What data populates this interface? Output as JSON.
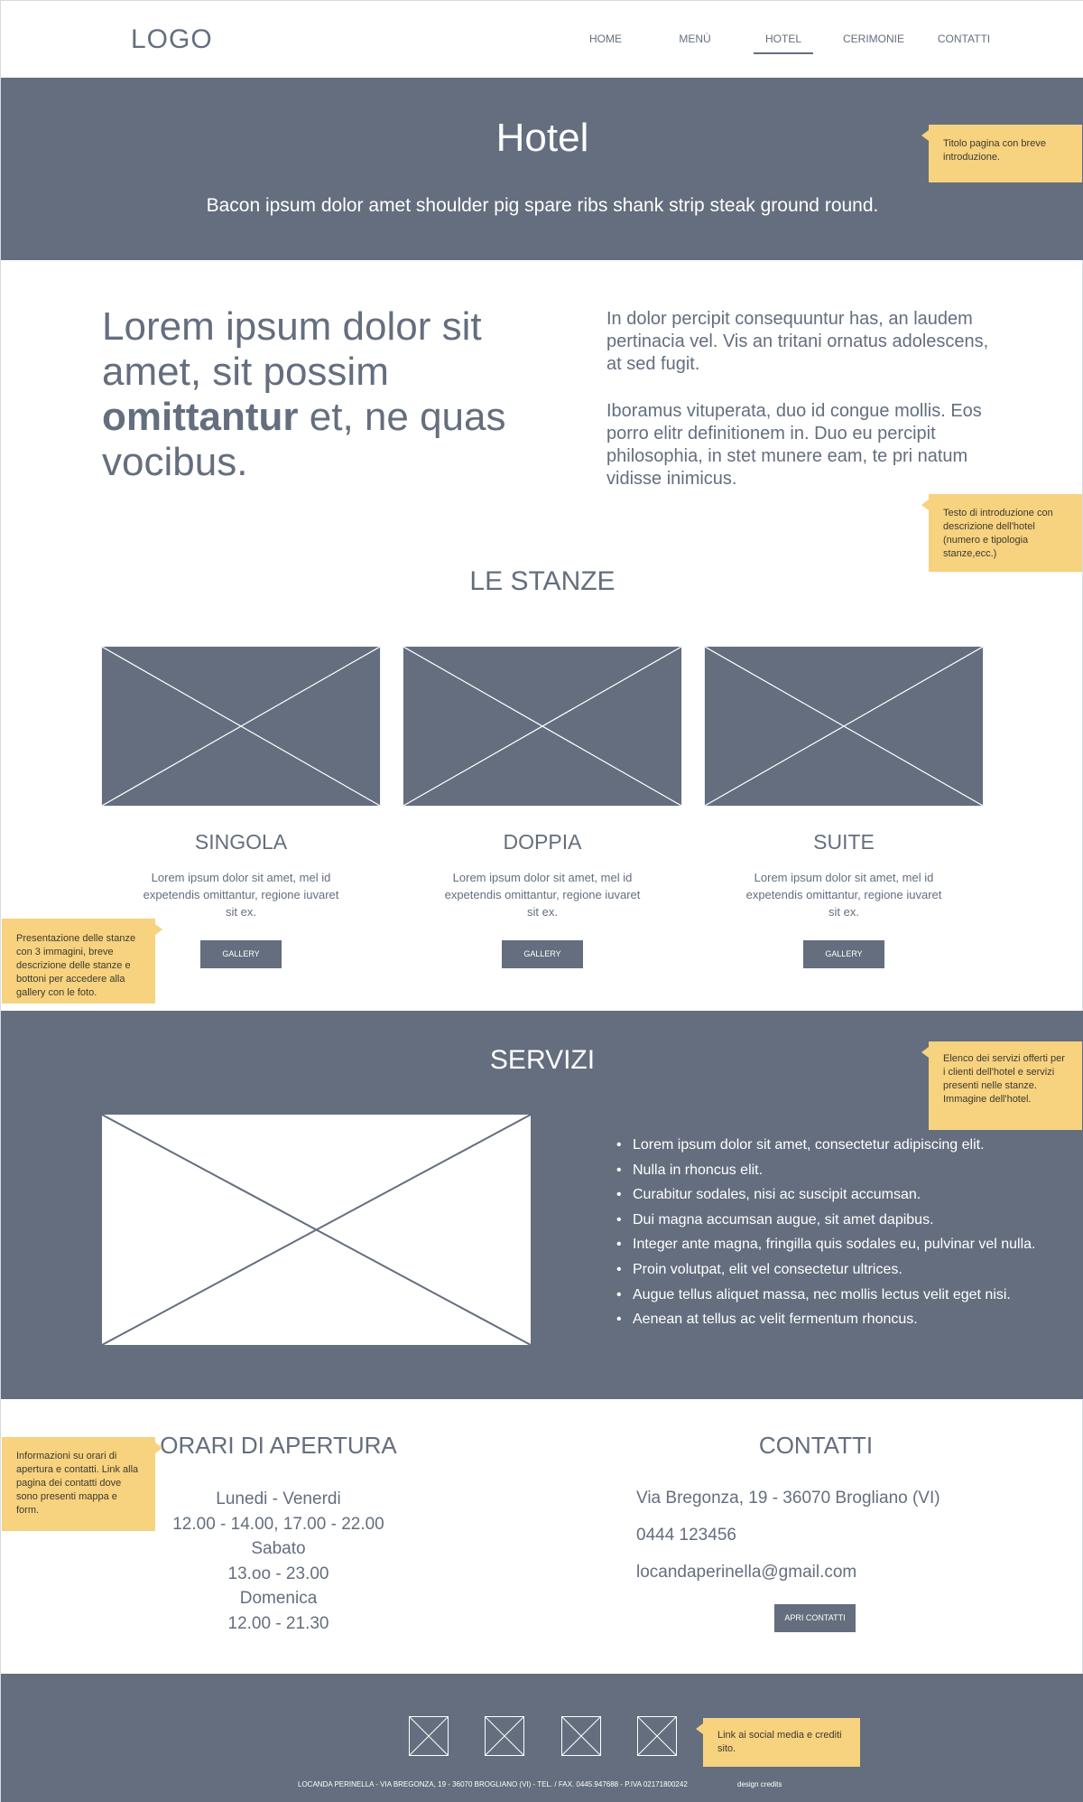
{
  "header": {
    "logo": "LOGO",
    "nav": [
      "HOME",
      "MENÙ",
      "HOTEL",
      "CERIMONIE",
      "CONTATTI"
    ],
    "active_nav": "HOTEL"
  },
  "hero": {
    "title": "Hotel",
    "subtitle": "Bacon ipsum dolor amet shoulder pig spare ribs shank strip steak ground round."
  },
  "notes": {
    "hero": "Titolo pagina con breve introduzione.",
    "intro": "Testo di introduzione con descrizione dell'hotel (numero e tipologia stanze,ecc.)",
    "rooms": "Presentazione delle stanze con 3 immagini, breve descrizione delle stanze e bottoni per accedere alla gallery con le foto.",
    "services": "Elenco dei servizi offerti per i clienti dell'hotel e servizi presenti nelle stanze. Immagine dell'hotel.",
    "hours": "Informazioni su orari di apertura e contatti. Link alla pagina dei contatti dove sono presenti mappa e form.",
    "social": "Link ai social media e crediti sito."
  },
  "intro": {
    "big_part1": "Lorem ipsum dolor sit amet, sit possim ",
    "big_bold": "omittantur",
    "big_part2": " et, ne quas vocibus.",
    "para1": "In dolor percipit consequuntur has, an laudem pertinacia vel. Vis an tritani ornatus adolescens, at sed fugit.",
    "para2": "Iboramus vituperata, duo id congue mollis. Eos porro elitr definitionem in. Duo eu percipit philosophia, in stet munere eam, te pri natum vidisse inimicus."
  },
  "rooms": {
    "title": "LE STANZE",
    "items": [
      {
        "name": "SINGOLA",
        "desc": "Lorem ipsum dolor sit amet, mel id expetendis omittantur, regione iuvaret sit ex.",
        "button": "GALLERY"
      },
      {
        "name": "DOPPIA",
        "desc": "Lorem ipsum dolor sit amet, mel id expetendis omittantur, regione iuvaret sit ex.",
        "button": "GALLERY"
      },
      {
        "name": "SUITE",
        "desc": "Lorem ipsum dolor sit amet, mel id expetendis omittantur, regione iuvaret sit ex.",
        "button": "GALLERY"
      }
    ]
  },
  "services": {
    "title": "SERVIZI",
    "items": [
      "Lorem ipsum dolor sit amet, consectetur adipiscing elit.",
      "Nulla in rhoncus elit.",
      "Curabitur sodales, nisi ac suscipit accumsan.",
      "Dui magna accumsan augue, sit amet dapibus.",
      "Integer ante magna, fringilla quis sodales eu, pulvinar vel nulla.",
      "Proin volutpat, elit vel consectetur ultrices.",
      "Augue tellus aliquet massa, nec mollis lectus velit eget nisi.",
      "Aenean at tellus ac velit fermentum rhoncus."
    ]
  },
  "hours": {
    "title": "ORARI DI APERTURA",
    "lines": [
      "Lunedi - Venerdi",
      "12.00 - 14.00, 17.00 - 22.00",
      "Sabato",
      "13.oo - 23.00",
      "Domenica",
      "12.00 - 21.30"
    ]
  },
  "contacts": {
    "title": "CONTATTI",
    "address": "Via Bregonza, 19 - 36070 Brogliano (VI)",
    "phone": "0444 123456",
    "email": "locandaperinella@gmail.com",
    "button": "APRI CONTATTI"
  },
  "footer": {
    "info": "LOCANDA PERINELLA - VIA BREGONZA, 19 - 36070 BROGLIANO (VI) - TEL. / FAX. 0445.947688 - P.IVA 02171800242",
    "credits": "design credits"
  },
  "colors": {
    "primary": "#646e7e",
    "note": "#f7d27f",
    "background": "#ffffff"
  }
}
